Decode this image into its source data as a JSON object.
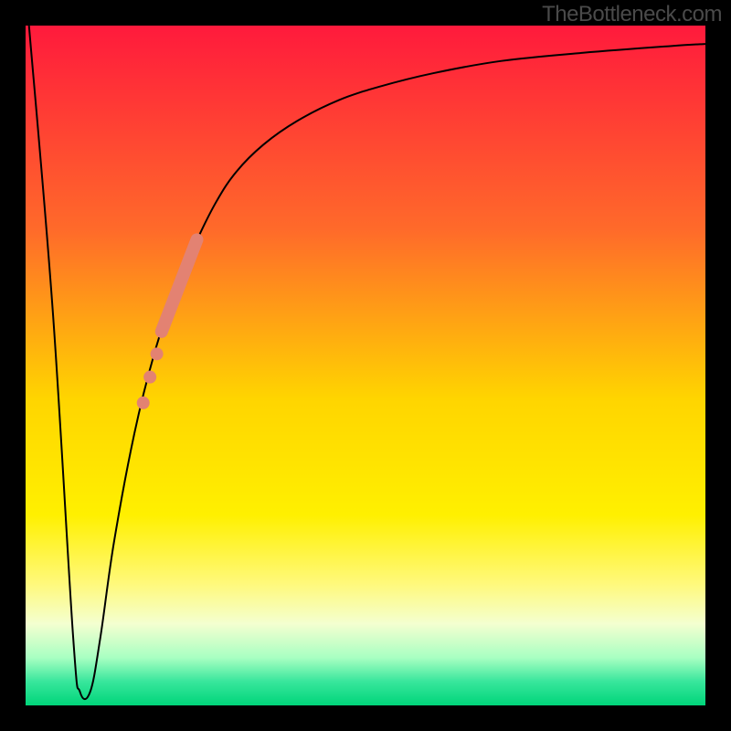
{
  "watermark": "TheBottleneck.com",
  "chart_data": {
    "type": "line",
    "title": "",
    "xlabel": "",
    "ylabel": "",
    "xlim": [
      0,
      100
    ],
    "ylim": [
      0,
      100
    ],
    "grid": false,
    "gradient_stops": [
      {
        "offset": 0,
        "color": "#ff1a3c"
      },
      {
        "offset": 0.3,
        "color": "#ff6a2a"
      },
      {
        "offset": 0.55,
        "color": "#ffd500"
      },
      {
        "offset": 0.72,
        "color": "#fff000"
      },
      {
        "offset": 0.82,
        "color": "#fff97a"
      },
      {
        "offset": 0.88,
        "color": "#f4ffd0"
      },
      {
        "offset": 0.93,
        "color": "#a8ffc2"
      },
      {
        "offset": 0.965,
        "color": "#38e69c"
      },
      {
        "offset": 1.0,
        "color": "#00d57a"
      }
    ],
    "series": [
      {
        "name": "bottleneck-curve",
        "type": "line",
        "color": "#000000",
        "stroke_width": 2,
        "x": [
          0.5,
          4.0,
          7.0,
          8.0,
          9.5,
          11.0,
          13.0,
          16.0,
          19.0,
          22.0,
          25.0,
          28.0,
          31.0,
          35.0,
          40.0,
          46.0,
          52.0,
          60.0,
          70.0,
          82.0,
          95.0,
          100.0
        ],
        "y": [
          100.0,
          58.0,
          10.0,
          2.0,
          2.0,
          10.0,
          24.0,
          40.0,
          52.0,
          61.0,
          68.0,
          74.0,
          78.5,
          82.5,
          86.0,
          89.0,
          91.0,
          93.0,
          94.8,
          96.0,
          97.0,
          97.3
        ]
      },
      {
        "name": "highlight-thick",
        "type": "line",
        "color": "#e38272",
        "stroke_width": 14,
        "linecap": "round",
        "x": [
          20.0,
          25.2
        ],
        "y": [
          55.0,
          68.5
        ]
      },
      {
        "name": "highlight-dots",
        "type": "scatter",
        "color": "#e38272",
        "radius": 7,
        "x": [
          17.3,
          18.3,
          19.3
        ],
        "y": [
          44.5,
          48.3,
          51.7
        ]
      }
    ]
  }
}
